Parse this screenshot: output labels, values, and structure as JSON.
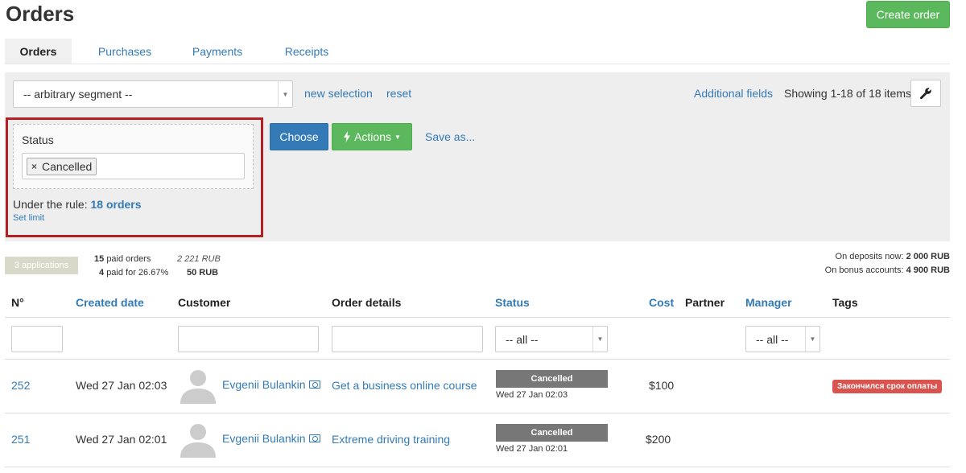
{
  "page": {
    "title": "Orders",
    "create_label": "Create order"
  },
  "tabs": [
    {
      "label": "Orders",
      "active": true
    },
    {
      "label": "Purchases",
      "active": false
    },
    {
      "label": "Payments",
      "active": false
    },
    {
      "label": "Receipts",
      "active": false
    }
  ],
  "filter": {
    "segment_value": "-- arbitrary segment --",
    "new_selection": "new selection",
    "reset": "reset",
    "additional_fields": "Additional fields",
    "showing": "Showing 1-18 of 18 items.",
    "status_label": "Status",
    "status_chip": "Cancelled",
    "chip_remove": "×",
    "rule_prefix": "Under the rule:",
    "rule_count": "18 orders",
    "set_limit": "Set limit",
    "choose": "Choose",
    "actions": "Actions",
    "save_as": "Save as..."
  },
  "summary": {
    "applications": "3 applications",
    "paid_count": "15",
    "paid_label": "paid orders",
    "paid_amount": "2 221 RUB",
    "partial_count": "4",
    "partial_label": "paid for 26.67%",
    "partial_amount": "50 RUB",
    "deposits_label": "On deposits now:",
    "deposits_value": "2 000 RUB",
    "bonus_label": "On bonus accounts:",
    "bonus_value": "4 900 RUB"
  },
  "table": {
    "headers": {
      "number": "N°",
      "created": "Created date",
      "customer": "Customer",
      "details": "Order details",
      "status": "Status",
      "cost": "Cost",
      "partner": "Partner",
      "manager": "Manager",
      "tags": "Tags"
    },
    "status_filter": "-- all --",
    "manager_filter": "-- all --",
    "rows": [
      {
        "id": "252",
        "created": "Wed 27 Jan 02:03",
        "customer": "Evgenii Bulankin",
        "details": "Get a business online course",
        "status": "Cancelled",
        "status_date": "Wed 27 Jan 02:03",
        "cost": "$100",
        "tag": "Закончился срок оплаты"
      },
      {
        "id": "251",
        "created": "Wed 27 Jan 02:01",
        "customer": "Evgenii Bulankin",
        "details": "Extreme driving training",
        "status": "Cancelled",
        "status_date": "Wed 27 Jan 02:01",
        "cost": "$200",
        "tag": ""
      }
    ]
  },
  "colors": {
    "primary": "#337ab7",
    "success": "#5cb85c",
    "danger": "#d9534f",
    "highlight_border": "#b52025"
  },
  "icons": {
    "wrench": "wrench-icon",
    "bolt": "bolt-icon",
    "money": "money-icon",
    "avatar": "user-silhouette-icon"
  }
}
